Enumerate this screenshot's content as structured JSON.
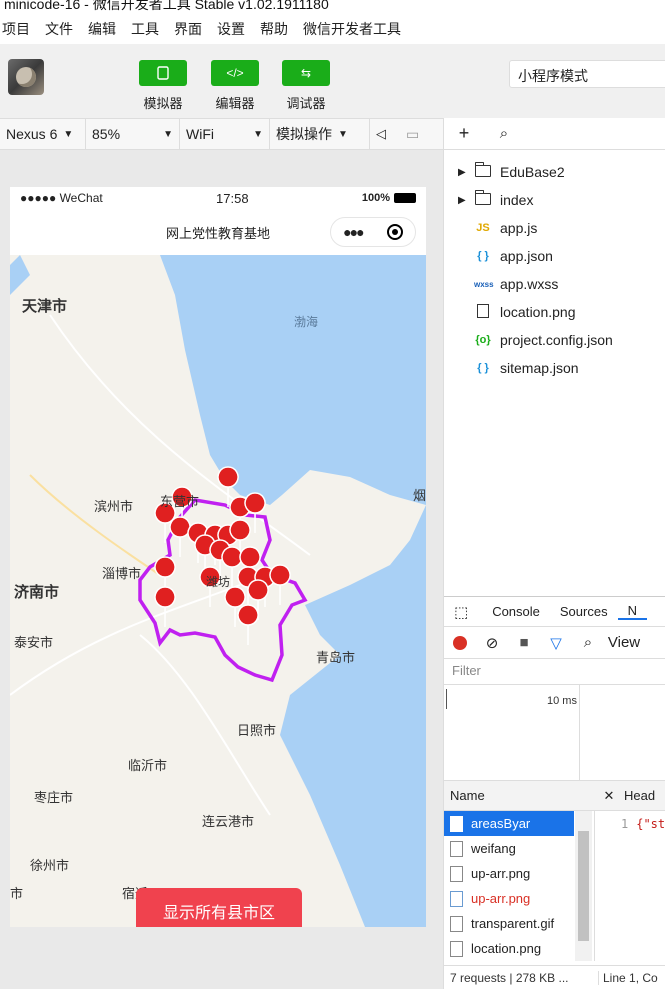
{
  "window": {
    "title": "minicode-16 - 微信开发者工具 Stable v1.02.1911180"
  },
  "menu": [
    "项目",
    "文件",
    "编辑",
    "工具",
    "界面",
    "设置",
    "帮助",
    "微信开发者工具"
  ],
  "toolbar": {
    "simulator": "模拟器",
    "editor": "编辑器",
    "debugger": "调试器",
    "mode": "小程序模式"
  },
  "devbar": {
    "device": "Nexus 6",
    "zoom": "85%",
    "network": "WiFi",
    "operation": "模拟操作"
  },
  "phone": {
    "carrier": "●●●●● WeChat",
    "time": "17:58",
    "battery": "100%",
    "nav_title": "网上党性教育基地",
    "button": "显示所有县市区"
  },
  "map": {
    "labels": [
      "天津市",
      "渤海",
      "滨州市",
      "东营市",
      "烟",
      "淄博市",
      "济南市",
      "泰安市",
      "潍坊",
      "青岛市",
      "日照市",
      "临沂市",
      "枣庄市",
      "连云港市",
      "徐州市",
      "宿迁",
      "市"
    ],
    "colors": {
      "sea": "#a9d0f5",
      "land": "#f4f2ec",
      "boundary": "#c020f0",
      "marker": "#e02020"
    }
  },
  "files": {
    "items": [
      {
        "name": "EduBase2",
        "type": "folder"
      },
      {
        "name": "index",
        "type": "folder"
      },
      {
        "name": "app.js",
        "type": "js",
        "icon": "JS"
      },
      {
        "name": "app.json",
        "type": "json",
        "icon": "{ }"
      },
      {
        "name": "app.wxss",
        "type": "wxss",
        "icon": "wxss"
      },
      {
        "name": "location.png",
        "type": "image"
      },
      {
        "name": "project.config.json",
        "type": "config",
        "icon": "{o}"
      },
      {
        "name": "sitemap.json",
        "type": "json",
        "icon": "{ }"
      }
    ]
  },
  "devtools": {
    "tabs": [
      "Console",
      "Sources",
      "N"
    ],
    "view_label": "View",
    "filter_placeholder": "Filter",
    "timeline_label": "10 ms",
    "name_header": "Name",
    "headers_header": "Head",
    "requests": [
      "areasByar",
      "weifang",
      "up-arr.png",
      "up-arr.png",
      "transparent.gif",
      "location.png"
    ],
    "response_line": "1",
    "response_text": "{\"st",
    "status_text": "7 requests  |  278 KB ...",
    "status_right": "Line 1, Co"
  }
}
